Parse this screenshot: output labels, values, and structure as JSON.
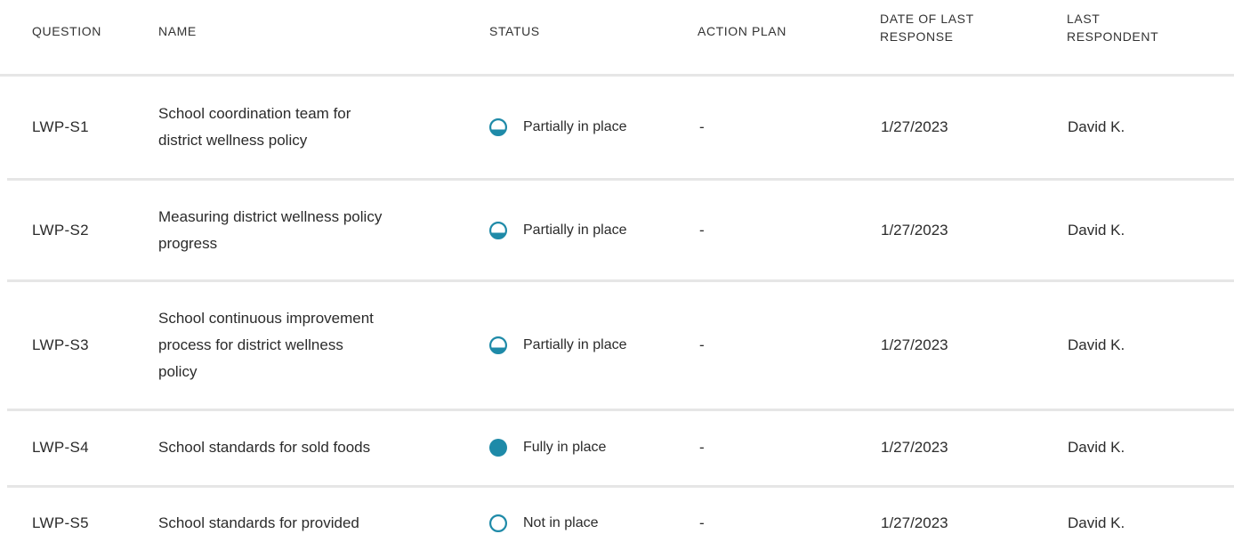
{
  "columns": {
    "question": "QUESTION",
    "name": "NAME",
    "status": "STATUS",
    "action_plan": "ACTION PLAN",
    "date_line1": "DATE OF LAST",
    "date_line2": "RESPONSE",
    "resp_line1": "LAST",
    "resp_line2": "RESPONDENT"
  },
  "rows": [
    {
      "question": "LWP-S1",
      "name_lines": [
        "School coordination team for",
        "district wellness policy"
      ],
      "status": "Partially in place",
      "status_icon": "partial-circle-icon",
      "action_plan": "-",
      "date": "1/27/2023",
      "respondent": "David K."
    },
    {
      "question": "LWP-S2",
      "name_lines": [
        "Measuring district wellness policy",
        "progress"
      ],
      "status": "Partially in place",
      "status_icon": "partial-circle-icon",
      "action_plan": "-",
      "date": "1/27/2023",
      "respondent": "David K."
    },
    {
      "question": "LWP-S3",
      "name_lines": [
        "School continuous improvement",
        "process for district wellness",
        "policy"
      ],
      "status": "Partially in place",
      "status_icon": "partial-circle-icon",
      "action_plan": "-",
      "date": "1/27/2023",
      "respondent": "David K."
    },
    {
      "question": "LWP-S4",
      "name_lines": [
        "School standards for sold foods"
      ],
      "status": "Fully in place",
      "status_icon": "full-circle-icon",
      "action_plan": "-",
      "date": "1/27/2023",
      "respondent": "David K."
    },
    {
      "question": "LWP-S5",
      "name_lines": [
        "School standards for provided"
      ],
      "status": "Not in place",
      "status_icon": "empty-circle-icon",
      "action_plan": "-",
      "date": "1/27/2023",
      "respondent": "David K."
    }
  ],
  "colors": {
    "status_accent": "#1e8aa8",
    "divider": "#e6e6e6"
  }
}
